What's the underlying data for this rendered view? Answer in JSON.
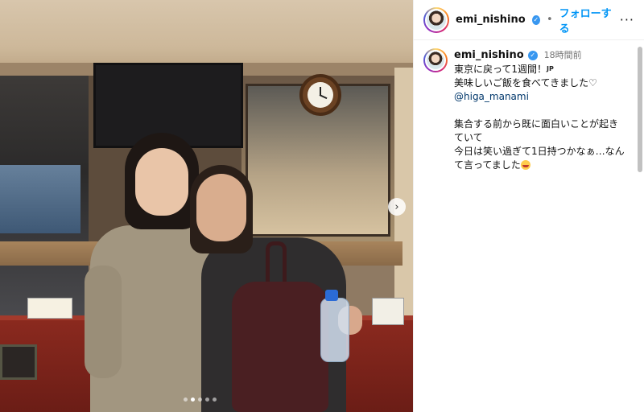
{
  "post": {
    "username": "emi_nishino",
    "follow_label": "フォローする",
    "separator": "•",
    "more_label": "···",
    "verified_mark": "✓",
    "caption": {
      "username": "emi_nishino",
      "time": "18時間前",
      "line1": "東京に戻って1週間！",
      "flag": "JP",
      "line2": "美味しいご飯を食べてきました",
      "heart": "♡",
      "mention": "@higa_manami",
      "line3": "集合する前から既に面白いことが起き",
      "line4": "ていて",
      "line5": "今日は笑い過ぎて1日持つかなぁ…なん",
      "line6": "て言ってました"
    }
  },
  "carousel": {
    "next_arrow": "›",
    "dot_count": 5,
    "active_dot": 1
  },
  "icons": {
    "verified": "verified-badge-icon",
    "more": "more-options-icon",
    "next": "chevron-right-icon",
    "emoji": "grinning-face-emoji"
  },
  "colors": {
    "link_blue": "#0095f6",
    "verified_blue": "#3897f0",
    "mention_blue": "#00376b"
  }
}
